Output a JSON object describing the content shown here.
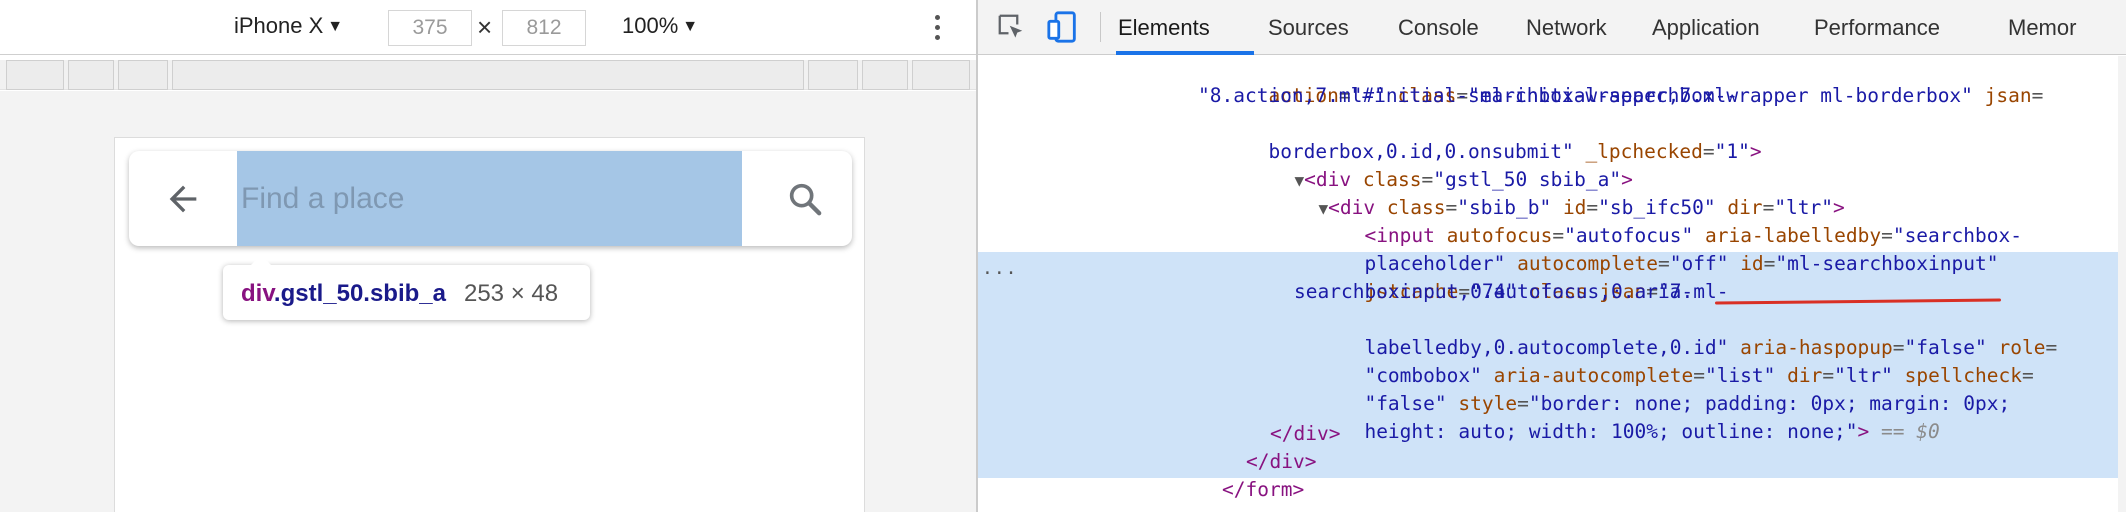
{
  "device_toolbar": {
    "device": "iPhone X",
    "width": "375",
    "height": "812",
    "times": "×",
    "zoom": "100%"
  },
  "viewport": {
    "search_placeholder": "Find a place",
    "tooltip_tag": "div",
    "tooltip_class": ".gstl_50.sbib_a",
    "tooltip_size": "253 × 48"
  },
  "devtools": {
    "tabs": [
      "Elements",
      "Sources",
      "Console",
      "Network",
      "Application",
      "Performance",
      "Memor"
    ],
    "code": {
      "l1": {
        "a1": "action",
        "v1": "\"#\"",
        "a2": "class",
        "v2": "\"ml-initial-searchbox-wrapper ml-borderbox\"",
        "a3": "jsan",
        "eq": "="
      },
      "l2": "\"8.action,7.ml-initial-searchbox-wrapper,7.ml-",
      "l3": {
        "text": "borderbox,0.id,0.onsubmit\"",
        "a1": "_lpchecked",
        "v1": "\"1\"",
        "close": ">"
      },
      "l4": {
        "open": "<div",
        "a1": "class",
        "v1": "\"gstl_50 sbib_a\"",
        "close": ">"
      },
      "l5": {
        "open": "<div",
        "a1": "class",
        "v1": "\"sbib_b\"",
        "a2": "id",
        "v2": "\"sb_ifc50\"",
        "a3": "dir",
        "v3": "\"ltr\"",
        "close": ">"
      },
      "l6": {
        "open": "<input",
        "a1": "autofocus",
        "v1": "\"autofocus\"",
        "a2": "aria-labelledby",
        "v2": "\"searchbox-"
      },
      "l7": {
        "v2b": "placeholder\"",
        "a3": "autocomplete",
        "v3": "\"off\"",
        "a4": "id",
        "v4": "\"ml-searchboxinput\""
      },
      "l8": {
        "a5": "jstcache",
        "v5": "\"74\"",
        "a6": "class",
        "a7": "jsan",
        "v7": "\"7.ml-"
      },
      "l9": "searchboxinput,0.autofocus,0.aria-",
      "l10": {
        "v7c": "labelledby,0.autocomplete,0.id\"",
        "a8": "aria-haspopup",
        "v8": "\"false\"",
        "a9": "role",
        "eq": "="
      },
      "l11": {
        "v9": "\"combobox\"",
        "a10": "aria-autocomplete",
        "v10": "\"list\"",
        "a11": "dir",
        "v11": "\"ltr\"",
        "a12": "spellcheck",
        "eq": "="
      },
      "l12": {
        "v12": "\"false\"",
        "a13": "style",
        "v13": "\"border: none; padding: 0px; margin: 0px;"
      },
      "l13": {
        "v13b": "height: auto; width: 100%; outline: none;\"",
        "close": ">",
        "dollar": "== $0"
      },
      "l14": "</div>",
      "l15": "</div>",
      "l16": "</form>",
      "ellipsis": "..."
    }
  },
  "colors": {
    "selection": "#cfe3f8",
    "highlight": "#a5c6e6",
    "tab_underline": "#1a73e8",
    "underline_mark": "#d93025",
    "tag": "#881280",
    "attr_name": "#994500",
    "attr_value": "#1a1aa6"
  }
}
